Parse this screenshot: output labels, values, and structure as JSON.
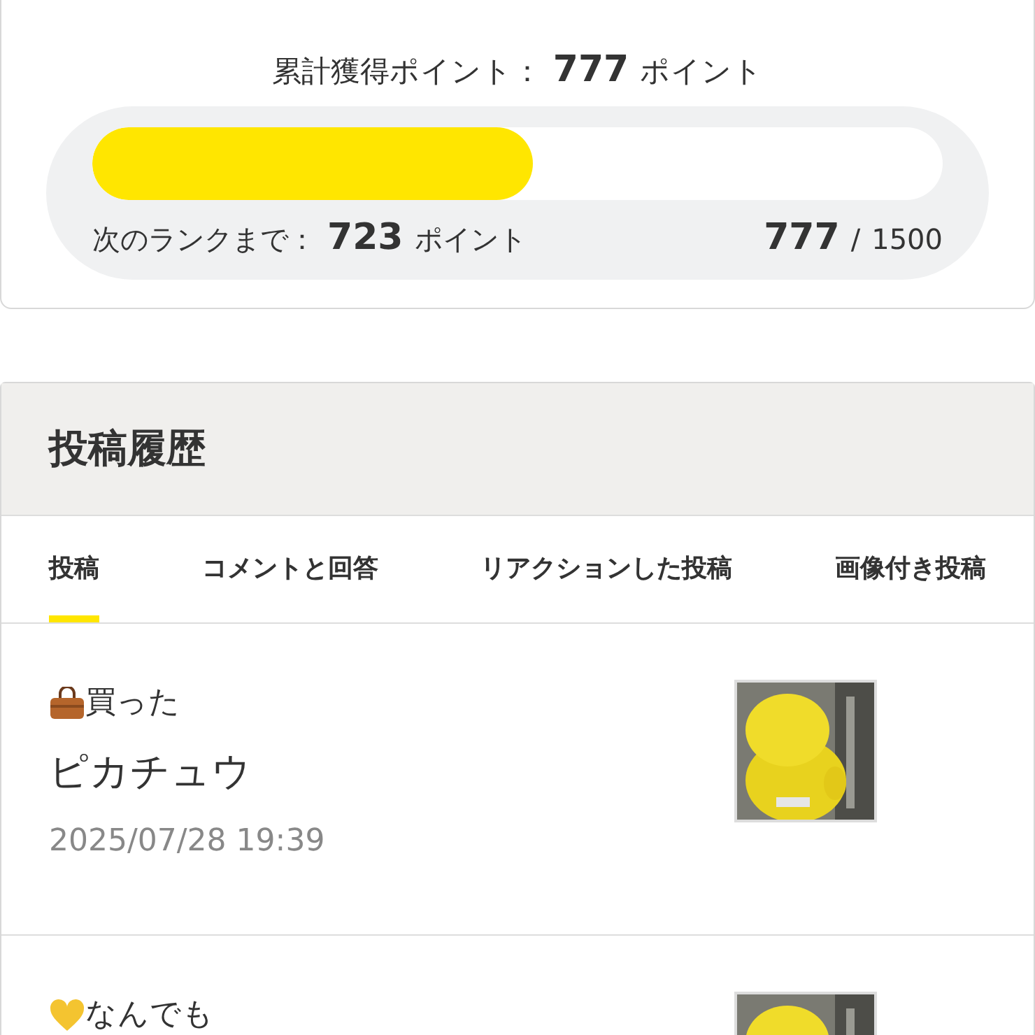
{
  "profile": {
    "total_label": "累計獲得ポイント：",
    "total_value": "777",
    "total_unit": "ポイント",
    "next_label": "次のランクまで：",
    "next_value": "723",
    "next_unit": "ポイント",
    "progress_current": "777",
    "progress_sep": "/",
    "progress_max": "1500",
    "level": 0.518
  },
  "history": {
    "title": "投稿履歴",
    "tabs": [
      {
        "label": "投稿",
        "selected": true
      },
      {
        "label": "コメントと回答",
        "selected": false
      },
      {
        "label": "リアクションした投稿",
        "selected": false
      },
      {
        "label": "画像付き投稿",
        "selected": false
      }
    ],
    "posts": [
      {
        "kind": "bag",
        "category": "買った",
        "title": "ピカチュウ",
        "date": "2025/07/28 19:39"
      },
      {
        "kind": "heart",
        "category": "なんでも"
      }
    ]
  }
}
